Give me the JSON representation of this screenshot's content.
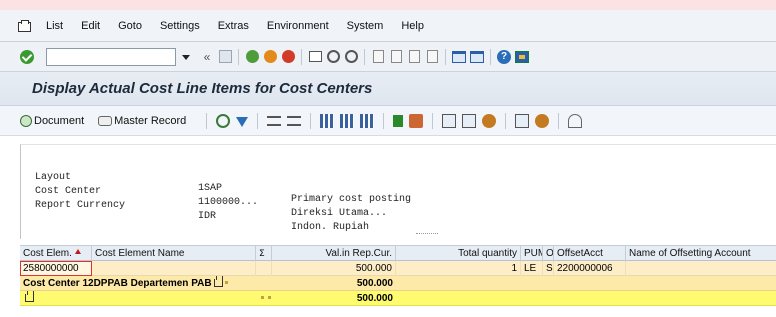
{
  "menu": {
    "items": [
      "List",
      "Edit",
      "Goto",
      "Settings",
      "Extras",
      "Environment",
      "System",
      "Help"
    ]
  },
  "toolbar": {
    "command_value": "",
    "back_glyph": "«"
  },
  "page": {
    "title": "Display Actual Cost Line Items for Cost Centers"
  },
  "app_toolbar": {
    "document_label": "Document",
    "master_record_label": "Master Record"
  },
  "header": {
    "rows": [
      {
        "label": "Layout",
        "value": "1SAP",
        "desc": "Primary cost posting"
      },
      {
        "label": "Cost Center",
        "value": "1100000...",
        "desc": "Direksi Utama..."
      },
      {
        "label": "Report Currency",
        "value": "IDR",
        "desc": "Indon. Rupiah"
      }
    ]
  },
  "grid": {
    "columns": {
      "cost_elem": "Cost Elem.",
      "cost_elem_name": "Cost Element Name",
      "sigma": "Σ",
      "val": "Val.in Rep.Cur.",
      "total_qty": "Total quantity",
      "pum": "PUM",
      "o": "O",
      "offset_acct": "OffsetAcct",
      "offset_name": "Name of Offsetting Account"
    },
    "item": {
      "cost_elem": "2580000000",
      "cost_elem_name": "",
      "val": "500.000",
      "total_qty": "1",
      "pum": "LE",
      "o": "S",
      "offset_acct": "2200000006",
      "offset_name": ""
    },
    "subtotal": {
      "label": "Cost Center 12DPPAB Departemen PAB",
      "val": "500.000"
    },
    "total": {
      "val": "500.000"
    }
  }
}
